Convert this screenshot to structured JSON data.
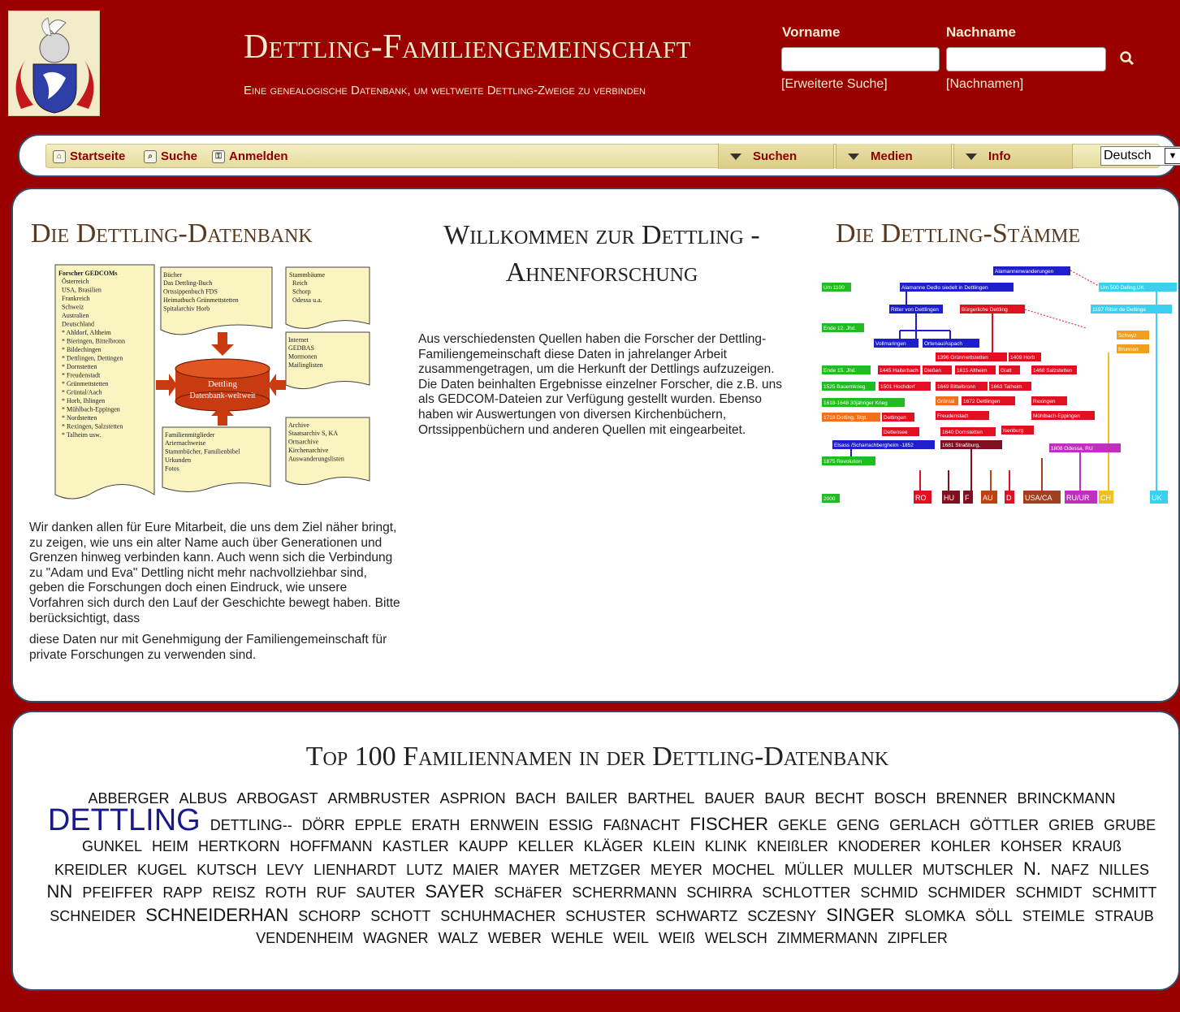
{
  "header": {
    "title": "Dettling-Familiengemeinschaft",
    "subtitle": "Eine genealogische Datenbank, um weltweite Dettling-Zweige zu verbinden",
    "search": {
      "first_name_label": "Vorname",
      "last_name_label": "Nachname",
      "first_name_value": "",
      "last_name_value": "",
      "advanced_link": "[Erweiterte Suche]",
      "surnames_link": "[Nachnamen]"
    }
  },
  "nav": {
    "items": [
      {
        "label": "Startseite",
        "icon": "home-icon"
      },
      {
        "label": "Suche",
        "icon": "search-icon"
      },
      {
        "label": "Anmelden",
        "icon": "login-icon"
      }
    ],
    "dropdowns": [
      "Suchen",
      "Medien",
      "Info"
    ],
    "language": "Deutsch"
  },
  "main": {
    "left_title": "Die Dettling-Datenbank",
    "center_title": "Willkommen zur Dettling - Ahnenforschung",
    "right_title": "Die Dettling-Stämme",
    "center_text": "Aus verschiedensten Quellen haben die Forscher der Dettling-Familiengemeinschaft diese Daten in jahrelanger Arbeit zusammengetragen, um die Herkunft der Dettlings aufzuzeigen. Die Daten beinhalten Ergebnisse einzelner Forscher, die z.B. uns als GEDCOM-Dateien zur Verfügung gestellt wurden. Ebenso haben wir Auswertungen von diversen Kirchenbüchern, Ortssippenbüchern und anderen Quellen mit eingearbeitet.",
    "left_text": "Wir danken allen für Eure Mitarbeit, die uns dem Ziel näher bringt, zu zeigen, wie uns ein alter Name auch über Generationen und Grenzen hinweg verbinden kann. Auch wenn sich die Verbindung zu \"Adam und Eva\" Dettling nicht mehr nachvollziehbar sind, geben die Forschungen doch einen Eindruck, wie unsere Vorfahren sich durch den Lauf der Geschichte bewegt haben. Bitte berücksichtigt, dass",
    "left_text_overflow": "diese Daten nur mit Genehmigung der Familiengemeinschaft für private Forschungen zu verwenden sind.",
    "diagram_left": {
      "box1_title": "Forscher GEDCOMs",
      "box1_items": [
        "Österreich",
        "USA, Brasilien",
        "Frankreich",
        "Schweiz",
        "Australien",
        "Deutschland",
        "* Ahldorf, Altheim",
        "* Bieringen, Bittelbronn",
        "* Bildechingen",
        "* Dettlingen, Dettingen",
        "* Dornstetten",
        "* Freudenstadt",
        "* Grünmettstetten",
        "* Grüntal/Aach",
        "* Horb, Ihlingen",
        "* Mühlbach-Eppingen",
        "* Nordstetten",
        "* Rexingen, Salzstetten",
        "* Talheim usw."
      ],
      "box2_title": "Bücher",
      "box2_items": [
        "Das Dettling-Buch",
        "Ortssippenbuch FDS",
        "Heimatbuch Grünmettstetten",
        "Spitalarchiv Horb"
      ],
      "box3_title": "Stammbäume",
      "box3_items": [
        "Reich",
        "Schorp",
        "Odessa u.a."
      ],
      "box4_title": "Internet",
      "box4_items": [
        "GEDBAS",
        "Mormonen",
        "Mailinglisten"
      ],
      "box5_title": "Familienmitglieder",
      "box5_items": [
        "Ariernachweise",
        "Stammbücher, Familienbibel",
        "Urkunden",
        "Fotos"
      ],
      "box6_title": "Archive",
      "box6_items": [
        "Staatsarchiv S, KA",
        "Ortsarchive",
        "Kirchenarchive",
        "Auswanderungslisten"
      ],
      "center_label1": "Dettling",
      "center_label2": "Datenbank-weltweit"
    },
    "diagram_right": {
      "labels": [
        "Alamannenwanderungen",
        "Alamanne Dedlo siedelt in Dettlingen",
        "Um 1100",
        "Um 500 Dellng,UK",
        "Ritter von Dettlingen",
        "Bürgerliche Dettling",
        "1197 Ritter de Detlinge",
        "Ende 12. Jhd.",
        "Vollmaringen",
        "Ortenau/Aspach",
        "Schwyz",
        "Brunnen",
        "1396 Grünmettstetten",
        "1409 Horb",
        "Ende 15. Jhd.",
        "1445 Haiterbach",
        "Dießen",
        "1615 Altheim",
        "Glatt",
        "1468 Salzstetten",
        "1525 Bauernkrieg",
        "1501 Hochdorf",
        "1649 Bittelbronn",
        "1663 Talheim",
        "1618-1648 30jähriger Krieg",
        "Grüntal",
        "1672 Dettlingen",
        "Rexingen",
        "1718 Dotting, Stgt.",
        "Dettingen",
        "Freudenstadt",
        "Mühlbach-Eppingen",
        "Dettensee",
        "1640 Dornstetten",
        "Isenburg",
        "Elsass /Scharrachbergheim -1852",
        "1681 Straßburg,",
        "1808 Odessa, RU",
        "1875 Revolution",
        "2000",
        "RO",
        "HU",
        "F",
        "AU",
        "D",
        "USA/CA",
        "RU/UR",
        "CH",
        "UK"
      ]
    }
  },
  "cloud": {
    "title": "Top 100 Familiennamen in der Dettling-Datenbank",
    "names": [
      {
        "n": "ABBERGER",
        "s": "m"
      },
      {
        "n": "ALBUS",
        "s": "m"
      },
      {
        "n": "ARBOGAST",
        "s": "m"
      },
      {
        "n": "ARMBRUSTER",
        "s": "m"
      },
      {
        "n": "ASPRION",
        "s": "m"
      },
      {
        "n": "BACH",
        "s": "m"
      },
      {
        "n": "BAILER",
        "s": "m"
      },
      {
        "n": "BARTHEL",
        "s": "m"
      },
      {
        "n": "BAUER",
        "s": "m"
      },
      {
        "n": "BAUR",
        "s": "m"
      },
      {
        "n": "BECHT",
        "s": "m"
      },
      {
        "n": "BOSCH",
        "s": "m"
      },
      {
        "n": "BRENNER",
        "s": "m"
      },
      {
        "n": "BRINCKMANN",
        "s": "m"
      },
      {
        "n": "DETTLING",
        "s": "xl"
      },
      {
        "n": "DETTLING--",
        "s": "m"
      },
      {
        "n": "DÖRR",
        "s": "m"
      },
      {
        "n": "EPPLE",
        "s": "m"
      },
      {
        "n": "ERATH",
        "s": "m"
      },
      {
        "n": "ERNWEIN",
        "s": "m"
      },
      {
        "n": "ESSIG",
        "s": "m"
      },
      {
        "n": "FAßNACHT",
        "s": "m"
      },
      {
        "n": "FISCHER",
        "s": "l"
      },
      {
        "n": "GEKLE",
        "s": "m"
      },
      {
        "n": "GENG",
        "s": "m"
      },
      {
        "n": "GERLACH",
        "s": "m"
      },
      {
        "n": "GÖTTLER",
        "s": "m"
      },
      {
        "n": "GRIEB",
        "s": "m"
      },
      {
        "n": "GRUBE",
        "s": "m"
      },
      {
        "n": "GUNKEL",
        "s": "m"
      },
      {
        "n": "HEIM",
        "s": "m"
      },
      {
        "n": "HERTKORN",
        "s": "m"
      },
      {
        "n": "HOFFMANN",
        "s": "m"
      },
      {
        "n": "KASTLER",
        "s": "m"
      },
      {
        "n": "KAUPP",
        "s": "m"
      },
      {
        "n": "KELLER",
        "s": "m"
      },
      {
        "n": "KLÄGER",
        "s": "m"
      },
      {
        "n": "KLEIN",
        "s": "m"
      },
      {
        "n": "KLINK",
        "s": "m"
      },
      {
        "n": "KNEIßLER",
        "s": "m"
      },
      {
        "n": "KNODERER",
        "s": "m"
      },
      {
        "n": "KOHLER",
        "s": "m"
      },
      {
        "n": "KOHSER",
        "s": "m"
      },
      {
        "n": "KRAUß",
        "s": "m"
      },
      {
        "n": "KREIDLER",
        "s": "m"
      },
      {
        "n": "KUGEL",
        "s": "m"
      },
      {
        "n": "KUTSCH",
        "s": "m"
      },
      {
        "n": "LEVY",
        "s": "m"
      },
      {
        "n": "LIENHARDT",
        "s": "m"
      },
      {
        "n": "LUTZ",
        "s": "m"
      },
      {
        "n": "MAIER",
        "s": "m"
      },
      {
        "n": "MAYER",
        "s": "m"
      },
      {
        "n": "METZGER",
        "s": "m"
      },
      {
        "n": "MEYER",
        "s": "m"
      },
      {
        "n": "MOCHEL",
        "s": "m"
      },
      {
        "n": "MÜLLER",
        "s": "m"
      },
      {
        "n": "MULLER",
        "s": "m"
      },
      {
        "n": "MUTSCHLER",
        "s": "m"
      },
      {
        "n": "N.",
        "s": "l"
      },
      {
        "n": "NAFZ",
        "s": "m"
      },
      {
        "n": "NILLES",
        "s": "m"
      },
      {
        "n": "NN",
        "s": "l"
      },
      {
        "n": "PFEIFFER",
        "s": "m"
      },
      {
        "n": "RAPP",
        "s": "m"
      },
      {
        "n": "REISZ",
        "s": "m"
      },
      {
        "n": "ROTH",
        "s": "m"
      },
      {
        "n": "RUF",
        "s": "m"
      },
      {
        "n": "SAUTER",
        "s": "m"
      },
      {
        "n": "SAYER",
        "s": "l"
      },
      {
        "n": "SCHäFER",
        "s": "m"
      },
      {
        "n": "SCHERRMANN",
        "s": "m"
      },
      {
        "n": "SCHIRRA",
        "s": "m"
      },
      {
        "n": "SCHLOTTER",
        "s": "m"
      },
      {
        "n": "SCHMID",
        "s": "m"
      },
      {
        "n": "SCHMIDER",
        "s": "m"
      },
      {
        "n": "SCHMIDT",
        "s": "m"
      },
      {
        "n": "SCHMITT",
        "s": "m"
      },
      {
        "n": "SCHNEIDER",
        "s": "m"
      },
      {
        "n": "SCHNEIDERHAN",
        "s": "l"
      },
      {
        "n": "SCHORP",
        "s": "m"
      },
      {
        "n": "SCHOTT",
        "s": "m"
      },
      {
        "n": "SCHUHMACHER",
        "s": "m"
      },
      {
        "n": "SCHUSTER",
        "s": "m"
      },
      {
        "n": "SCHWARTZ",
        "s": "m"
      },
      {
        "n": "SCZESNY",
        "s": "m"
      },
      {
        "n": "SINGER",
        "s": "l"
      },
      {
        "n": "SLOMKA",
        "s": "m"
      },
      {
        "n": "SÖLL",
        "s": "m"
      },
      {
        "n": "STEIMLE",
        "s": "m"
      },
      {
        "n": "STRAUB",
        "s": "m"
      },
      {
        "n": "VENDENHEIM",
        "s": "m"
      },
      {
        "n": "WAGNER",
        "s": "m"
      },
      {
        "n": "WALZ",
        "s": "m"
      },
      {
        "n": "WEBER",
        "s": "m"
      },
      {
        "n": "WEHLE",
        "s": "m"
      },
      {
        "n": "WEIL",
        "s": "m"
      },
      {
        "n": "WEIß",
        "s": "m"
      },
      {
        "n": "WELSCH",
        "s": "m"
      },
      {
        "n": "ZIMMERMANN",
        "s": "m"
      },
      {
        "n": "ZIPFLER",
        "s": "m"
      }
    ]
  },
  "colors": {
    "brand_red": "#9b0000",
    "nav_bg": "#e6dc9e",
    "title_brown": "#5a3a1e",
    "accent_blue": "#18198f"
  }
}
